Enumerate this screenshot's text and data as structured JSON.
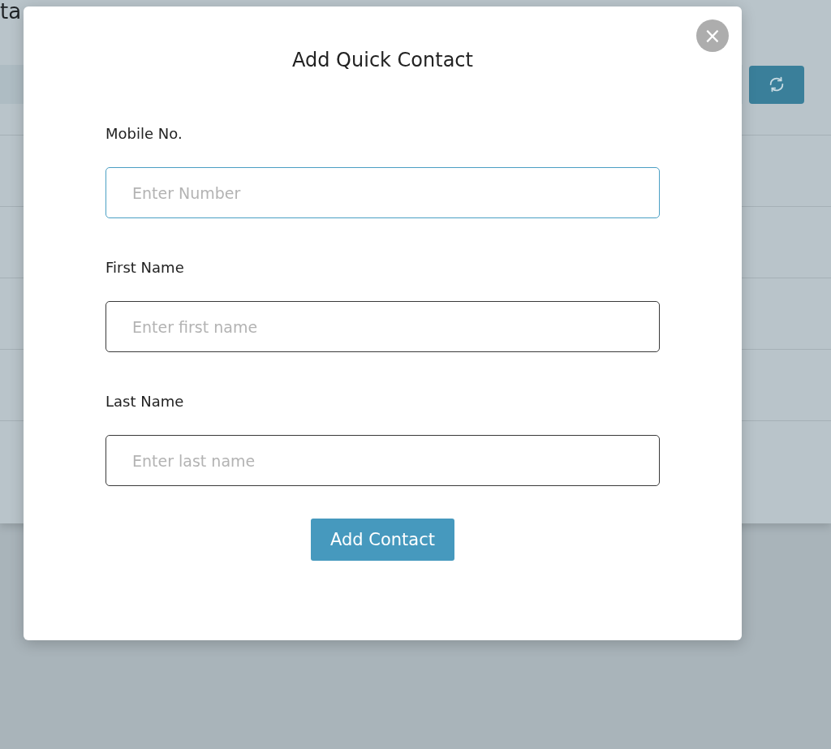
{
  "page": {
    "heading": "ta"
  },
  "modal": {
    "title": "Add Quick Contact",
    "close": "×",
    "fields": [
      {
        "label": "Mobile No.",
        "placeholder": "Enter Number",
        "focused": true
      },
      {
        "label": "First Name",
        "placeholder": "Enter first name",
        "focused": false
      },
      {
        "label": "Last Name",
        "placeholder": "Enter last name",
        "focused": false
      }
    ],
    "submit": "Add Contact"
  }
}
